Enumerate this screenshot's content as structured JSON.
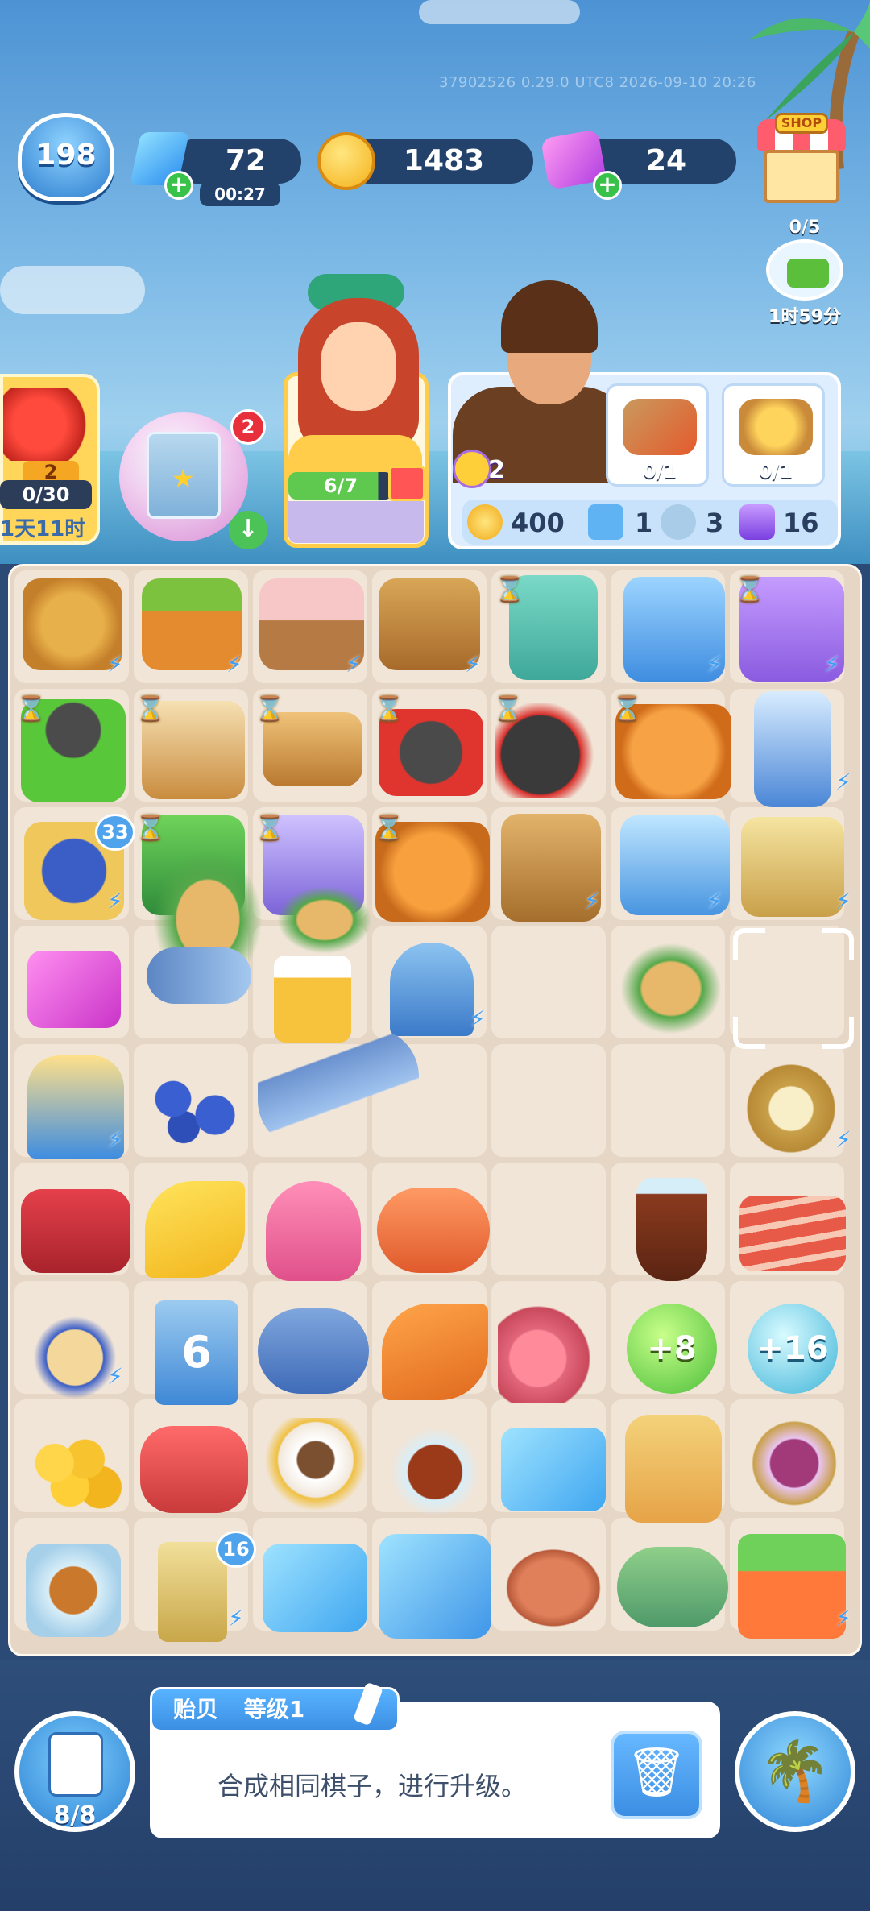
{
  "watermark": "37902526 0.29.0 UTC8 2026-09-10 20:26",
  "header": {
    "level": "198",
    "energy": "72",
    "energy_timer": "00:27",
    "coins": "1483",
    "gems": "24",
    "shop_label": "SHOP"
  },
  "delivery": {
    "progress": "0/5",
    "timer": "1时59分"
  },
  "event": {
    "rank": "2",
    "progress": "0/30",
    "progress_fraction": 0.0,
    "timer": "1天11时"
  },
  "pack": {
    "badge": "2"
  },
  "customer_girl": {
    "progress": "6/7",
    "progress_fraction": 0.857
  },
  "order": {
    "likes": "2",
    "requests": [
      {
        "name": "spiced-fish-plate",
        "count": "0/1"
      },
      {
        "name": "egg-tart-plate",
        "count": "0/1"
      }
    ],
    "rewards": [
      {
        "icon": "coin-icon",
        "value": "400"
      },
      {
        "icon": "recipe-card-icon",
        "value": "1"
      },
      {
        "icon": "tornado-icon",
        "value": "3"
      },
      {
        "icon": "energy-icon",
        "value": "16"
      }
    ]
  },
  "board": {
    "badges": {
      "basket_pot": "33",
      "totem": "16"
    },
    "orbs": [
      {
        "label": "+8",
        "color": "#4cbe3a"
      },
      {
        "label": "+16",
        "color": "#3fb4d8"
      }
    ],
    "calendar_number": "6"
  },
  "bottom": {
    "fridge_count": "8/8",
    "item_name": "贻贝",
    "item_level": "等级1",
    "description": "合成相同棋子，进行升级。"
  }
}
